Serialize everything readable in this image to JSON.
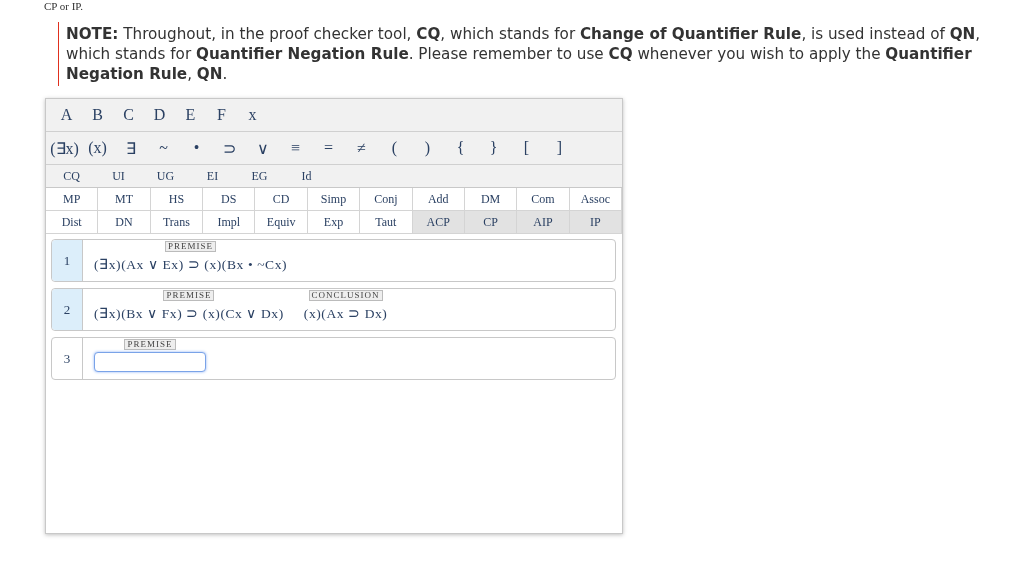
{
  "intro_text": "CP or IP.",
  "note": "**NOTE:** Throughout, in the proof checker tool, **CQ**, which stands for **Change of Quantifier Rule**, is used instead of **QN**, which stands for **Quantifier Negation Rule**. Please remember to use **CQ** whenever you wish to apply the **Quantifier Negation Rule**, **QN**.",
  "letters": [
    "A",
    "B",
    "C",
    "D",
    "E",
    "F",
    "x"
  ],
  "symbols": [
    "(∃x)",
    "(x)",
    "∃",
    "~",
    "•",
    "⊃",
    "∨",
    "≡",
    "=",
    "≠",
    "(",
    ")",
    "{",
    "}",
    "[",
    "]"
  ],
  "quantifier_rules": [
    "CQ",
    "UI",
    "UG",
    "EI",
    "EG",
    "Id"
  ],
  "rule_rows": [
    [
      {
        "label": "MP",
        "disabled": false
      },
      {
        "label": "MT",
        "disabled": false
      },
      {
        "label": "HS",
        "disabled": false
      },
      {
        "label": "DS",
        "disabled": false
      },
      {
        "label": "CD",
        "disabled": false
      },
      {
        "label": "Simp",
        "disabled": false
      },
      {
        "label": "Conj",
        "disabled": false
      },
      {
        "label": "Add",
        "disabled": false
      },
      {
        "label": "DM",
        "disabled": false
      },
      {
        "label": "Com",
        "disabled": false
      },
      {
        "label": "Assoc",
        "disabled": false
      }
    ],
    [
      {
        "label": "Dist",
        "disabled": false
      },
      {
        "label": "DN",
        "disabled": false
      },
      {
        "label": "Trans",
        "disabled": false
      },
      {
        "label": "Impl",
        "disabled": false
      },
      {
        "label": "Equiv",
        "disabled": false
      },
      {
        "label": "Exp",
        "disabled": false
      },
      {
        "label": "Taut",
        "disabled": false
      },
      {
        "label": "ACP",
        "disabled": true
      },
      {
        "label": "CP",
        "disabled": true
      },
      {
        "label": "AIP",
        "disabled": true
      },
      {
        "label": "IP",
        "disabled": true
      }
    ]
  ],
  "proof_lines": [
    {
      "kind": "formula",
      "number": "1",
      "given": true,
      "tag": "PREMISE",
      "formula": "(∃x)(Ax ∨ Ex) ⊃ (x)(Bx • ~Cx)"
    },
    {
      "kind": "formula",
      "number": "2",
      "given": true,
      "tag": "PREMISE",
      "formula": "(∃x)(Bx ∨ Fx) ⊃ (x)(Cx ∨ Dx)",
      "conclusion": {
        "tag": "CONCLUSION",
        "formula": "(x)(Ax ⊃ Dx)"
      }
    },
    {
      "kind": "input",
      "number": "3",
      "given": false,
      "tag": "PREMISE",
      "focused": true
    }
  ]
}
